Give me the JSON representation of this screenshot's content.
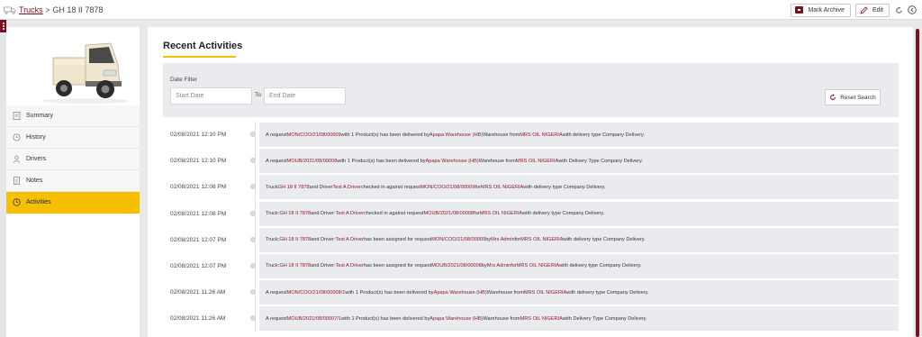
{
  "breadcrumb": {
    "parent": "Trucks",
    "separator": ">",
    "current": "GH 18 II 7878"
  },
  "toolbar": {
    "archive_label": "Mark Archive",
    "edit_label": "Edit"
  },
  "sidebar": {
    "items": [
      {
        "label": "Summary",
        "icon": "summary-icon",
        "active": false
      },
      {
        "label": "History",
        "icon": "history-icon",
        "active": false
      },
      {
        "label": "Drivers",
        "icon": "driver-icon",
        "active": false
      },
      {
        "label": "Notes",
        "icon": "notes-icon",
        "active": false
      },
      {
        "label": "Activities",
        "icon": "activity-icon",
        "active": true
      }
    ]
  },
  "main": {
    "title": "Recent Activities",
    "filter": {
      "label": "Date Filter",
      "start_placeholder": "Start Date",
      "to_label": "To",
      "end_placeholder": "End Date",
      "reset_label": "Reset Search"
    },
    "activities": [
      {
        "date": "02/08/2021 12:10 PM",
        "parts": [
          [
            "A request ",
            false
          ],
          [
            "MON/COO/21/08/00009",
            true
          ],
          [
            " with 1 Product(s) has been delivered by ",
            false
          ],
          [
            "Apapa Warehouse (HB)",
            true
          ],
          [
            " Warehouse from ",
            false
          ],
          [
            "MRS OIL NIGERIA",
            true
          ],
          [
            " with delivery type Company Delivery.",
            false
          ]
        ]
      },
      {
        "date": "02/08/2021 12:10 PM",
        "parts": [
          [
            "A request ",
            false
          ],
          [
            "MOUB/2021/08/00008",
            true
          ],
          [
            " with 1 Product(s) has been delivered by ",
            false
          ],
          [
            "Apapa Warehouse (HB)",
            true
          ],
          [
            " Warehouse from ",
            false
          ],
          [
            "MRS OIL NIGERIA",
            true
          ],
          [
            " with Delivery Type Company Delivery.",
            false
          ]
        ]
      },
      {
        "date": "02/08/2021 12:08 PM",
        "parts": [
          [
            "Truck ",
            false
          ],
          [
            "GH 18 II 7878",
            true
          ],
          [
            " and Driver ",
            false
          ],
          [
            "Test A Driver",
            true
          ],
          [
            " checked in against request ",
            false
          ],
          [
            "MON/COO/21/08/00009",
            true
          ],
          [
            " for ",
            false
          ],
          [
            "MRS OIL NIGERIA",
            true
          ],
          [
            " with delivery type Company Delivery.",
            false
          ]
        ]
      },
      {
        "date": "02/08/2021 12:08 PM",
        "parts": [
          [
            "Truck: ",
            false
          ],
          [
            "GH 18 II 7878",
            true
          ],
          [
            " and Driver: ",
            false
          ],
          [
            "Test A Driver",
            true
          ],
          [
            " checked in against request ",
            false
          ],
          [
            "MOUB/2021/08/00008",
            true
          ],
          [
            " for ",
            false
          ],
          [
            "MRS OIL NIGERIA",
            true
          ],
          [
            " with delivery type Company Delivery.",
            false
          ]
        ]
      },
      {
        "date": "02/08/2021 12:07 PM",
        "parts": [
          [
            "Truck: ",
            false
          ],
          [
            "GH 18 II 7878",
            true
          ],
          [
            " and Driver: ",
            false
          ],
          [
            "Test A Driver",
            true
          ],
          [
            " has been assigned for request ",
            false
          ],
          [
            "MON/COO/21/08/00009",
            true
          ],
          [
            " by ",
            false
          ],
          [
            "Mrs Admin",
            true
          ],
          [
            " for ",
            false
          ],
          [
            "MRS OIL NIGERIA",
            true
          ],
          [
            " with delivery type Company Delivery.",
            false
          ]
        ]
      },
      {
        "date": "02/08/2021 12:07 PM",
        "parts": [
          [
            "Truck: ",
            false
          ],
          [
            "GH 18 II 7878",
            true
          ],
          [
            " and Driver: ",
            false
          ],
          [
            "Test A Driver",
            true
          ],
          [
            " has been assigned for request ",
            false
          ],
          [
            "MOUB/2021/08/00008",
            true
          ],
          [
            " by ",
            false
          ],
          [
            "Mrs Admin",
            true
          ],
          [
            " for ",
            false
          ],
          [
            "MRS OIL NIGERIA",
            true
          ],
          [
            " with delivery type Company Delivery.",
            false
          ]
        ]
      },
      {
        "date": "02/08/2021 11:26 AM",
        "parts": [
          [
            "A request ",
            false
          ],
          [
            "MON/COO/21/08/00008/1",
            true
          ],
          [
            " with 1 Product(s) has been delivered by ",
            false
          ],
          [
            "Apapa Warehouse (HB)",
            true
          ],
          [
            " Warehouse from ",
            false
          ],
          [
            "MRS OIL NIGERIA",
            true
          ],
          [
            " with delivery type Company Delivery.",
            false
          ]
        ]
      },
      {
        "date": "02/08/2021 11:26 AM",
        "parts": [
          [
            "A request ",
            false
          ],
          [
            "MOUB/2021/08/00007/1",
            true
          ],
          [
            " with 1 Product(s) has been delivered by ",
            false
          ],
          [
            "Apapa Warehouse (HB)",
            true
          ],
          [
            " Warehouse from ",
            false
          ],
          [
            "MRS OIL NIGERIA",
            true
          ],
          [
            " with Delivery Type Company Delivery.",
            false
          ]
        ]
      }
    ]
  },
  "colors": {
    "brand": "#7a1020",
    "accent": "#f6c000",
    "link": "#8b1a2b"
  }
}
